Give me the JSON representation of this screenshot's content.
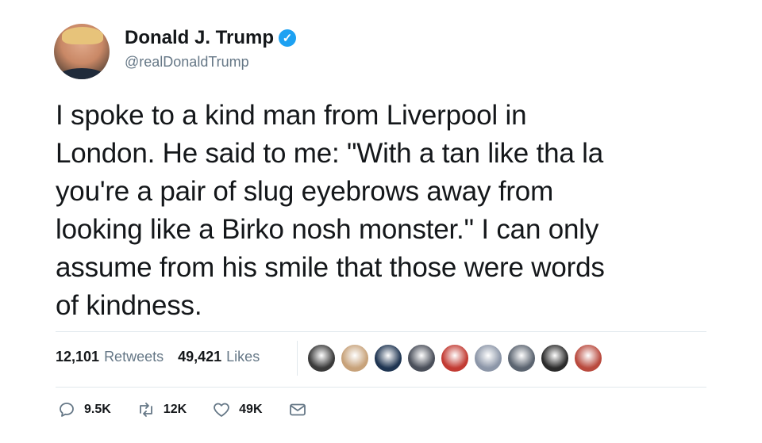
{
  "author": {
    "display_name": "Donald J. Trump",
    "handle": "@realDonaldTrump",
    "verified_mark": "✓"
  },
  "tweet": {
    "text": "I spoke to a kind man from Liverpool in\nLondon. He said to me: \"With a tan like tha la\nyou're a pair of slug eyebrows away from\nlooking like a Birko nosh monster.\" I can only\nassume from his smile that those were words\nof kindness."
  },
  "stats": {
    "retweets_count": "12,101",
    "retweets_label": "Retweets",
    "likes_count": "49,421",
    "likes_label": "Likes"
  },
  "likers": {
    "avatar_colors": [
      "#3a3a3a",
      "#c7a27a",
      "#1f3552",
      "#4a4f5a",
      "#c23b33",
      "#8c96a8",
      "#5b6470",
      "#2b2b2b",
      "#b94a3e"
    ]
  },
  "actions": {
    "replies": "9.5K",
    "retweets": "12K",
    "likes": "49K"
  },
  "colors": {
    "accent": "#1da1f2",
    "secondary_text": "#657786",
    "divider": "#e1e8ed"
  }
}
